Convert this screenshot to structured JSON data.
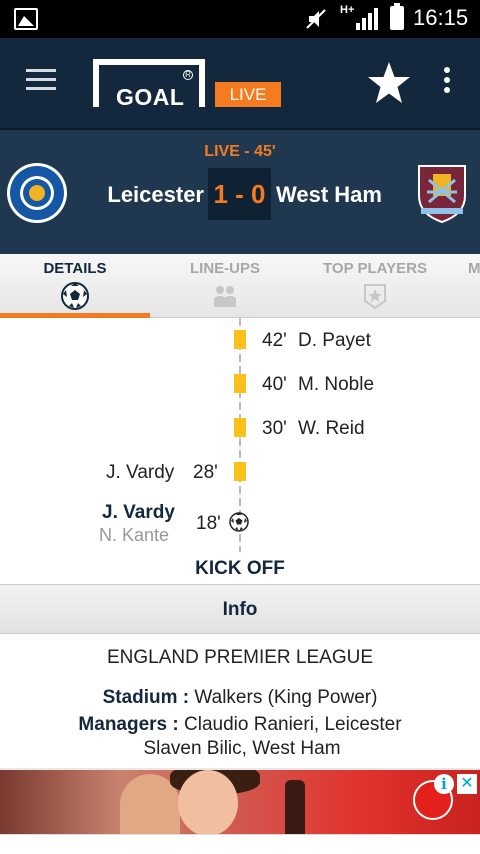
{
  "status_bar": {
    "network": "H+",
    "time": "16:15"
  },
  "app_bar": {
    "logo_text": "GOAL",
    "live_badge": "LIVE"
  },
  "match": {
    "status": "LIVE - 45'",
    "home_team": "Leicester",
    "away_team": "West Ham",
    "score": "1 - 0"
  },
  "tabs": [
    {
      "label": "DETAILS",
      "icon": "soccer-ball-icon",
      "active": true
    },
    {
      "label": "LINE-UPS",
      "icon": "players-icon",
      "active": false
    },
    {
      "label": "TOP PLAYERS",
      "icon": "star-badge-icon",
      "active": false
    },
    {
      "label": "M",
      "icon": "",
      "active": false
    }
  ],
  "timeline": {
    "events": [
      {
        "side": "away",
        "type": "yellow-card",
        "minute": "42'",
        "player": "D. Payet"
      },
      {
        "side": "away",
        "type": "yellow-card",
        "minute": "40'",
        "player": "M. Noble"
      },
      {
        "side": "away",
        "type": "yellow-card",
        "minute": "30'",
        "player": "W. Reid"
      },
      {
        "side": "home",
        "type": "yellow-card",
        "minute": "28'",
        "player": "J. Vardy"
      },
      {
        "side": "home",
        "type": "goal",
        "minute": "18'",
        "player": "J. Vardy",
        "assist": "N. Kante"
      }
    ],
    "kickoff_label": "KICK OFF"
  },
  "info": {
    "header": "Info",
    "league": "ENGLAND PREMIER LEAGUE",
    "stadium_label": "Stadium :",
    "stadium_value": "Walkers (King Power)",
    "managers_label": "Managers :",
    "managers_home": "Claudio Ranieri, Leicester",
    "managers_away": "Slaven Bilic, West Ham"
  },
  "colors": {
    "accent": "#f47b20",
    "navy": "#13283d",
    "card": "#f9c11a"
  }
}
